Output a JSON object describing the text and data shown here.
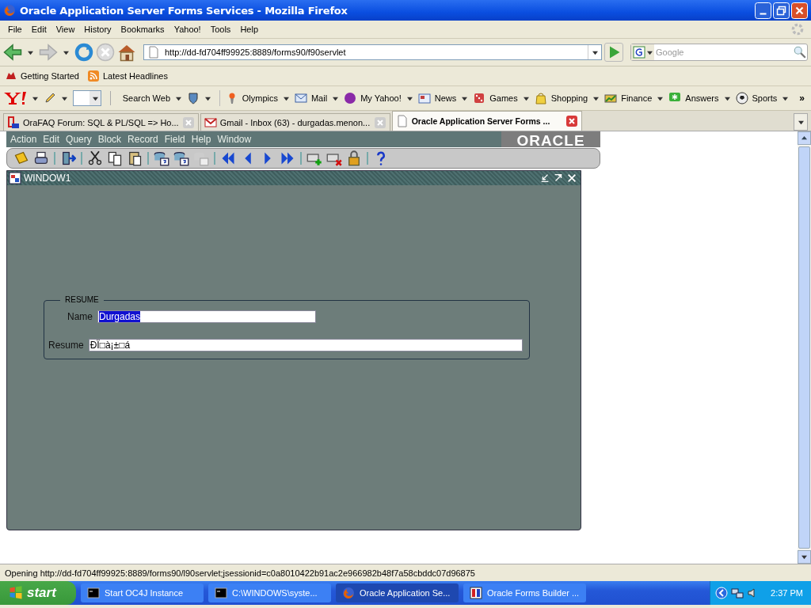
{
  "window": {
    "title": "Oracle Application Server Forms Services - Mozilla Firefox"
  },
  "menu": [
    "File",
    "Edit",
    "View",
    "History",
    "Bookmarks",
    "Yahoo!",
    "Tools",
    "Help"
  ],
  "navigation": {
    "url": "http://dd-fd704ff99925:8889/forms90/f90servlet",
    "search_placeholder": "Google"
  },
  "bookmarks": [
    "Getting Started",
    "Latest Headlines"
  ],
  "yahoo_toolbar": [
    "Search Web",
    "Olympics",
    "Mail",
    "My Yahoo!",
    "News",
    "Games",
    "Shopping",
    "Finance",
    "Answers",
    "Sports"
  ],
  "toolbar_overflow": "»",
  "tabs": [
    {
      "label": "OraFAQ Forum: SQL & PL/SQL => Ho...",
      "selected": false
    },
    {
      "label": "Gmail - Inbox (63) - durgadas.menon...",
      "selected": false
    },
    {
      "label": "Oracle Application Server Forms ...",
      "selected": true
    }
  ],
  "forms_menu": [
    "Action",
    "Edit",
    "Query",
    "Block",
    "Record",
    "Field",
    "Help",
    "Window"
  ],
  "forms_logo": "ORACLE",
  "forms_window": {
    "title": "WINDOW1",
    "frame": {
      "title": "RESUME",
      "fields": [
        {
          "label": "Name",
          "value": "Durgadas",
          "selected": true
        },
        {
          "label": "Resume",
          "value": "ĐÏ□à¡±□á",
          "selected": false
        }
      ]
    }
  },
  "status_bar": "Opening http://dd-fd704ff99925:8889/forms90/l90servlet;jsessionid=c0a8010422b91ac2e966982b48f7a58cbddc07d96875",
  "taskbar": {
    "start": "start",
    "items": [
      {
        "label": "Start OC4J Instance",
        "selected": false
      },
      {
        "label": "C:\\WINDOWS\\syste...",
        "selected": false
      },
      {
        "label": "Oracle Application Se...",
        "selected": true
      },
      {
        "label": "Oracle Forms Builder ...",
        "selected": false
      }
    ],
    "clock": "2:37 PM"
  }
}
